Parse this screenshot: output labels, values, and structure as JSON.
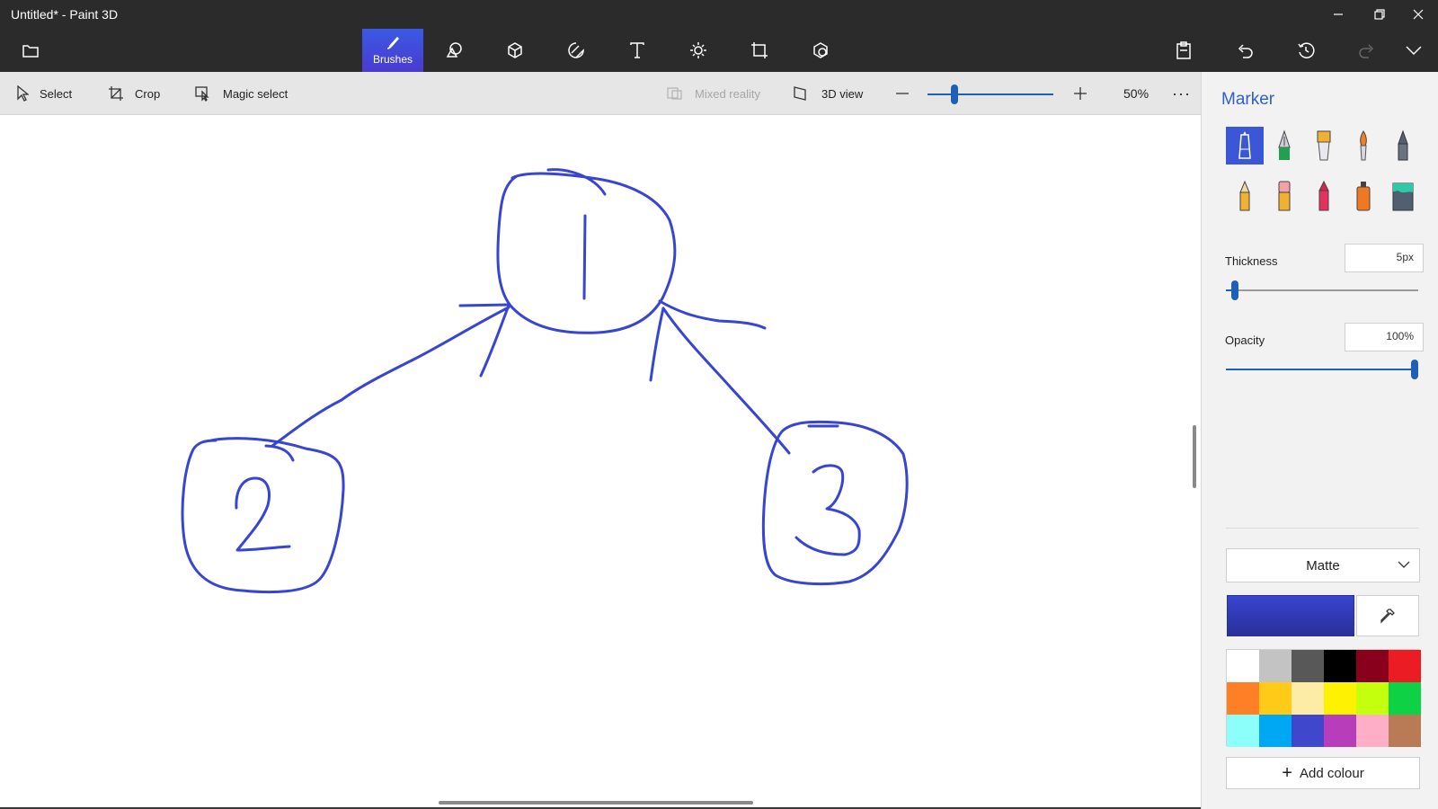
{
  "window": {
    "title": "Untitled* - Paint 3D"
  },
  "main_toolbar": {
    "brushes_label": "Brushes",
    "tools": [
      "brushes",
      "2d-shapes",
      "3d-shapes",
      "stickers",
      "text",
      "effects",
      "canvas",
      "3d-library"
    ]
  },
  "sub_toolbar": {
    "select_label": "Select",
    "crop_label": "Crop",
    "magic_select_label": "Magic select",
    "mixed_reality_label": "Mixed reality",
    "view_3d_label": "3D view",
    "zoom_value": "50%",
    "zoom_fraction": 0.2
  },
  "panel": {
    "title": "Marker",
    "brushes": [
      "marker",
      "calligraphy-pen",
      "oil-brush",
      "watercolor",
      "pixel-pen",
      "pencil",
      "eraser",
      "crayon",
      "spray-can",
      "fill"
    ],
    "selected_brush": "marker",
    "thickness_label": "Thickness",
    "thickness_value": "5px",
    "thickness_fraction": 0.03,
    "opacity_label": "Opacity",
    "opacity_value": "100%",
    "opacity_fraction": 1.0,
    "finish_value": "Matte",
    "current_color": "#3845d0",
    "palette": [
      "#ffffff",
      "#c3c3c3",
      "#585858",
      "#000000",
      "#88001b",
      "#ec1c24",
      "#ff7f27",
      "#ffca18",
      "#fdeca6",
      "#fff200",
      "#c4ff0e",
      "#0ed145",
      "#8cfffb",
      "#00a8f3",
      "#3f48cc",
      "#b83dba",
      "#ffaec8",
      "#b97a56"
    ],
    "add_colour_label": "Add colour"
  },
  "canvas": {
    "stroke_color": "#3845d0",
    "drawing_labels": [
      "1",
      "2",
      "3"
    ]
  }
}
